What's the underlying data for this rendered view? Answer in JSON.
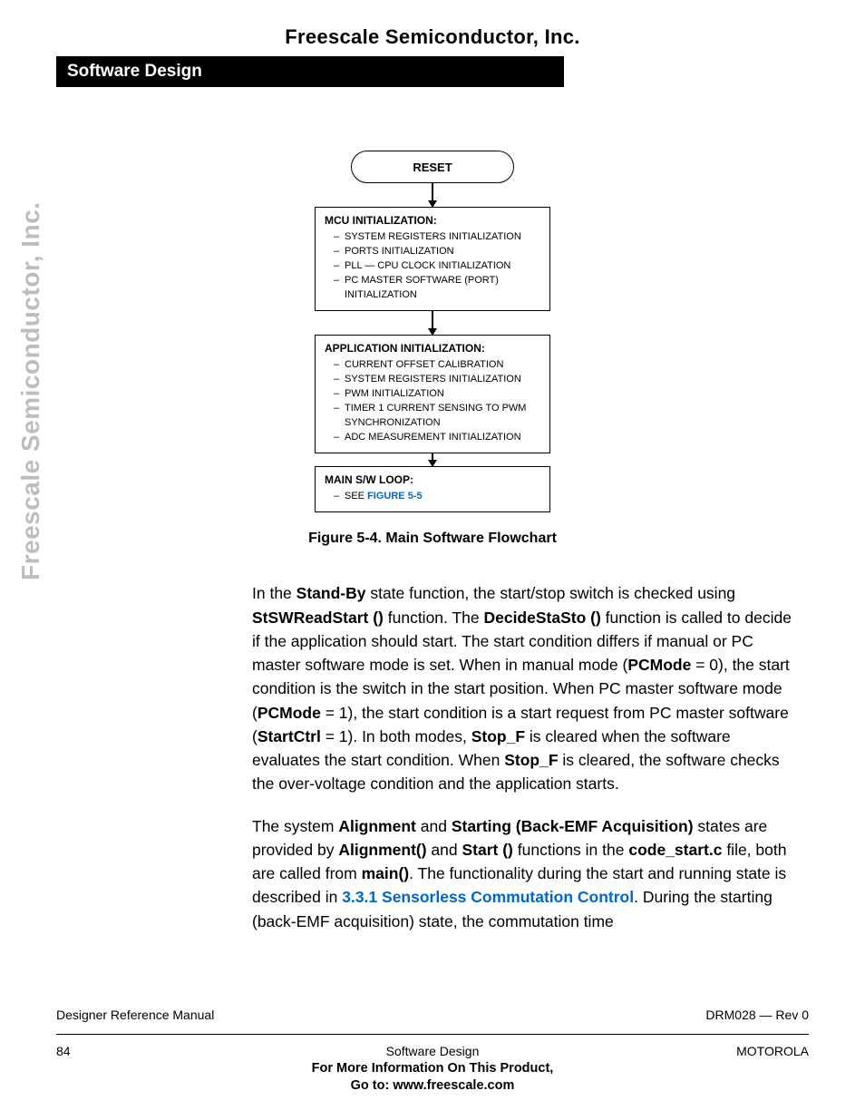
{
  "header": {
    "company": "Freescale Semiconductor, Inc."
  },
  "section_bar": "Software Design",
  "sidetext": "Freescale Semiconductor, Inc.",
  "flow": {
    "reset": "RESET",
    "box1_title": "MCU INITIALIZATION:",
    "box1_items": [
      "SYSTEM REGISTERS INITIALIZATION",
      "PORTS INITIALIZATION",
      "PLL — CPU CLOCK INITIALIZATION",
      "PC MASTER SOFTWARE (PORT) INITIALIZATION"
    ],
    "box2_title": "APPLICATION INITIALIZATION:",
    "box2_items": [
      "CURRENT OFFSET CALIBRATION",
      "SYSTEM REGISTERS INITIALIZATION",
      "PWM INITIALIZATION",
      "TIMER 1 CURRENT SENSING TO PWM SYNCHRONIZATION",
      "ADC MEASUREMENT INITIALIZATION"
    ],
    "box3_title": "MAIN S/W LOOP:",
    "box3_see": "SEE ",
    "box3_link": "FIGURE 5-5"
  },
  "caption": "Figure 5-4. Main Software Flowchart",
  "para1": {
    "t1": "In the ",
    "b1": "Stand-By",
    "t2": " state function, the start/stop switch is checked using ",
    "b2": "StSWReadStart ()",
    "t3": " function. The ",
    "b3": "DecideStaSto ()",
    "t4": " function is called to decide if the application should start. The start condition differs if manual or PC master software mode is set. When in manual mode (",
    "b4": "PCMode",
    "t5": " = 0), the start condition is the switch in the start position. When PC master software mode (",
    "b5": "PCMode",
    "t6": " = 1), the start condition is a start request from PC master software (",
    "b6": "StartCtrl",
    "t7": " = 1). In both modes, ",
    "b7": "Stop_F",
    "t8": " is cleared when the software evaluates the start condition. When ",
    "b8": "Stop_F",
    "t9": " is cleared, the software checks the over-voltage condition and the application starts."
  },
  "para2": {
    "t1": "The system ",
    "b1": "Alignment",
    "t2": " and ",
    "b2": "Starting (Back-EMF Acquisition)",
    "t3": " states are provided by ",
    "b3": "Alignment()",
    "t4": " and ",
    "b4": "Start ()",
    "t5": " functions in the ",
    "b5": "code_start.c",
    "t6": " file, both are called from ",
    "b6": "main()",
    "t7": ". The functionality during the start and running state is described in ",
    "link": "3.3.1 Sensorless Commutation Control",
    "t8": ". During the starting (back-EMF acquisition) state, the commutation time"
  },
  "footer": {
    "left1": "Designer Reference Manual",
    "right1": "DRM028 — Rev 0",
    "page": "84",
    "center2": "Software Design",
    "right2": "MOTOROLA",
    "bold1": "For More Information On This Product,",
    "bold2": "Go to: www.freescale.com"
  }
}
